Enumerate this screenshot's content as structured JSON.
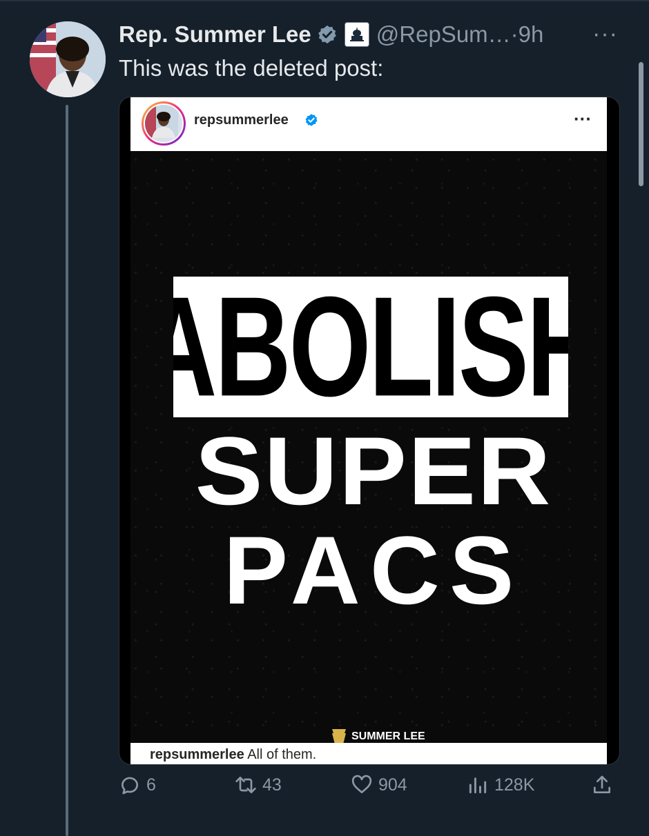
{
  "tweet": {
    "author_name": "Rep. Summer Lee",
    "handle_time": "@RepSum…·9h",
    "more_label": "···",
    "text": "This was the deleted post:",
    "actions": {
      "replies": "6",
      "retweets": "43",
      "likes": "904",
      "views": "128K"
    }
  },
  "embedded_post": {
    "username": "repsummerlee",
    "more_label": "···",
    "poster_line1": "ABOLISH",
    "poster_line2": "SUPER",
    "poster_line3": "PACS",
    "logo_text": "SUMMER LEE",
    "caption_user": "repsummerlee",
    "caption_text": "All of them."
  },
  "colors": {
    "background": "#15202b",
    "secondary_text": "#8b98a5",
    "verified": "#829aab"
  }
}
